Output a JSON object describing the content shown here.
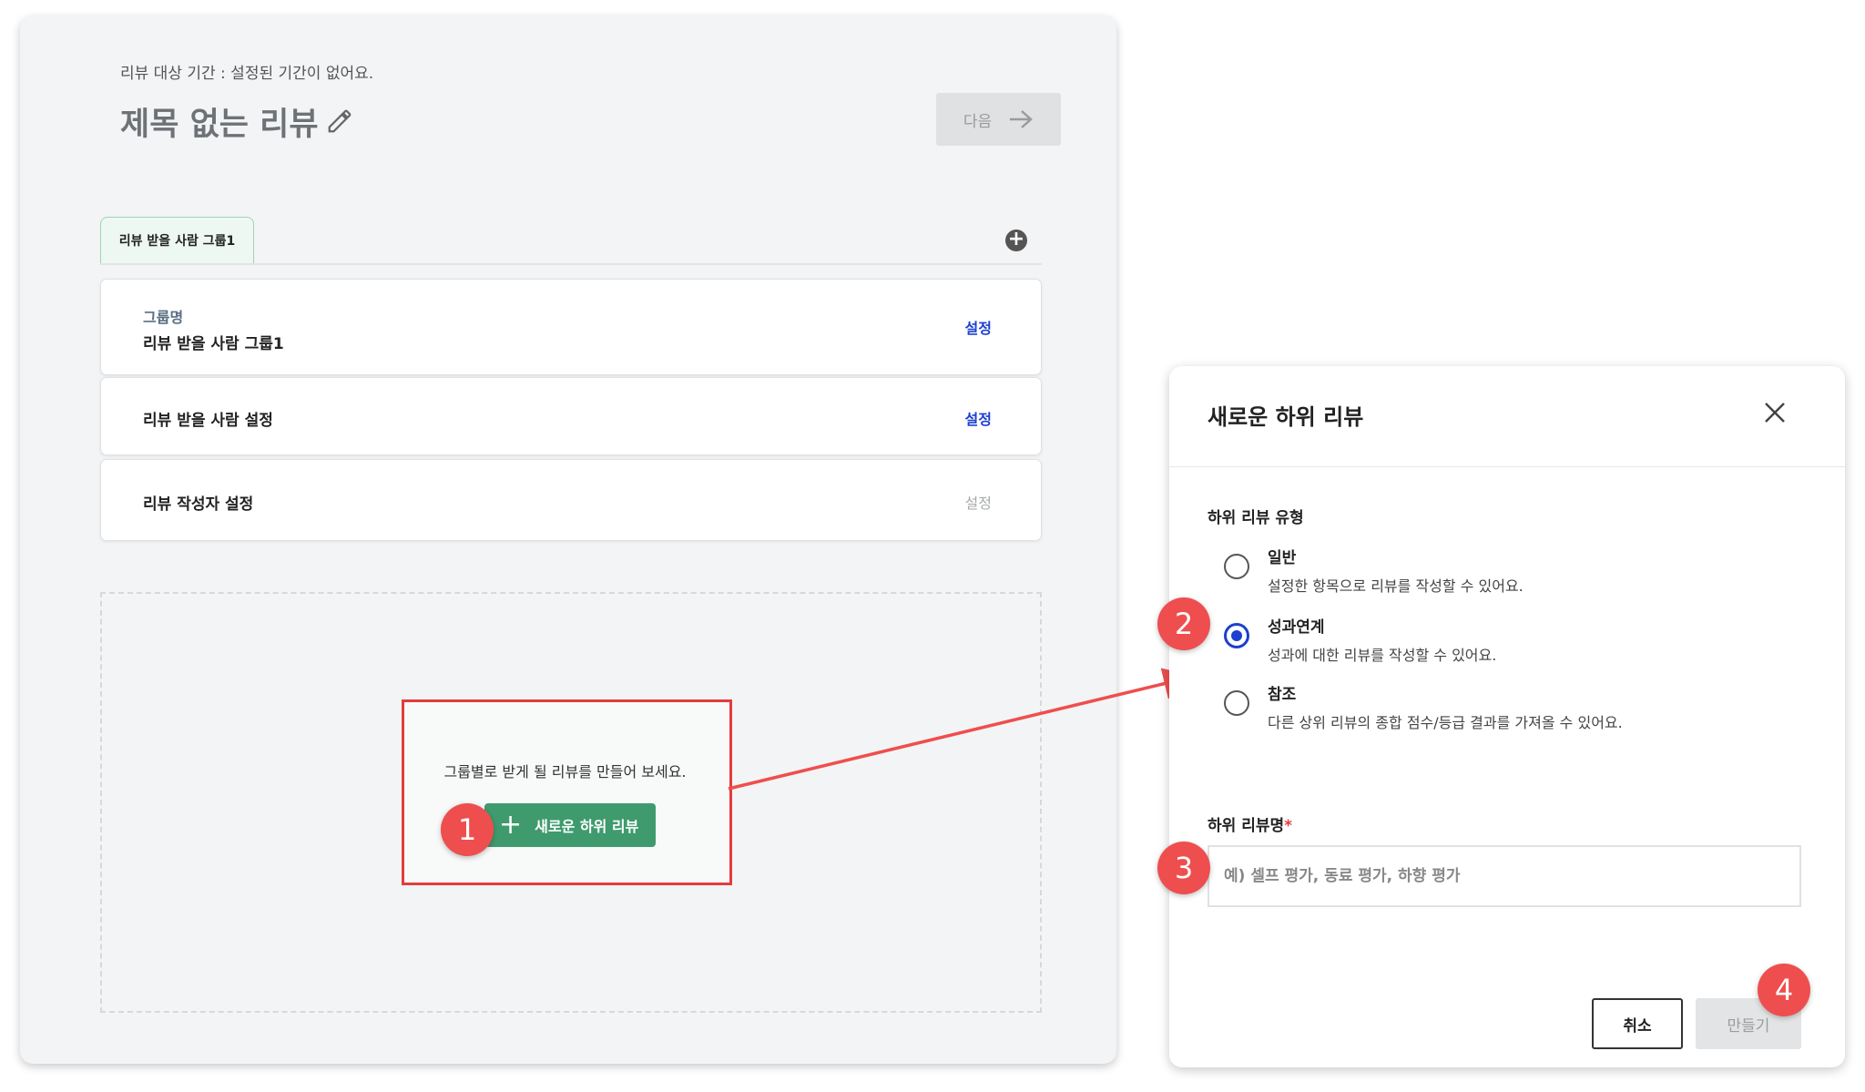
{
  "left_panel": {
    "period_text": "리뷰 대상 기간 : 설정된 기간이 없어요.",
    "title": "제목 없는 리뷰",
    "next_button": "다음",
    "tab_label": "리뷰 받을 사람 그룹1",
    "cards": [
      {
        "sub": "그룹명",
        "label": "리뷰 받을 사람 그룹1",
        "link": "설정"
      },
      {
        "label": "리뷰 받을 사람 설정",
        "link": "설정"
      },
      {
        "label": "리뷰 작성자 설정",
        "link": "설정"
      }
    ],
    "empty_message": "그룹별로 받게 될 리뷰를 만들어 보세요.",
    "create_button": "새로운 하위 리뷰"
  },
  "modal": {
    "title": "새로운 하위 리뷰",
    "type_label": "하위 리뷰 유형",
    "options": [
      {
        "title": "일반",
        "desc": "설정한 항목으로 리뷰를 작성할 수 있어요."
      },
      {
        "title": "성과연계",
        "desc": "성과에 대한 리뷰를 작성할 수 있어요."
      },
      {
        "title": "참조",
        "desc": "다른 상위 리뷰의 종합 점수/등급 결과를 가져올 수 있어요."
      }
    ],
    "selected_option": "성과연계",
    "name_label": "하위 리뷰명",
    "required_mark": "*",
    "name_placeholder": "예) 셀프 평가, 동료 평가, 하향 평가",
    "cancel_button": "취소",
    "create_button": "만들기"
  },
  "badges": [
    "1",
    "2",
    "3",
    "4"
  ],
  "colors": {
    "accent_green": "#3f9b6d",
    "link_blue": "#1c3fd1",
    "annotation_red": "#ef4e4e"
  }
}
